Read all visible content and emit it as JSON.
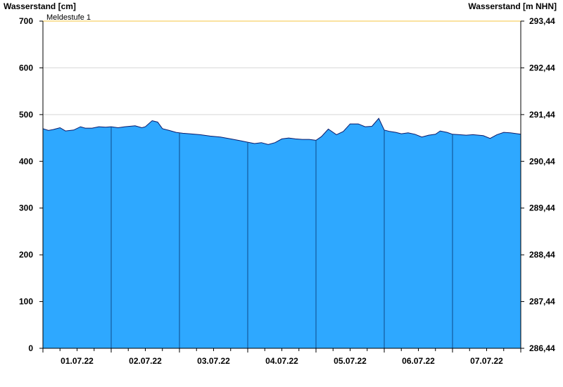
{
  "chart_data": {
    "type": "area",
    "ylabel_left": "Wasserstand [cm]",
    "ylabel_right": "Wasserstand [m NHN]",
    "ylim": [
      0,
      700
    ],
    "yticks_left": [
      0,
      100,
      200,
      300,
      400,
      500,
      600,
      700
    ],
    "yticks_right": [
      "286,44",
      "287,44",
      "288,44",
      "289,44",
      "290,44",
      "291,44",
      "292,44",
      "293,44"
    ],
    "days": [
      "01.07.22",
      "02.07.22",
      "03.07.22",
      "04.07.22",
      "05.07.22",
      "06.07.22",
      "07.07.22"
    ],
    "threshold": {
      "label": "Meldestufe 1",
      "value": 700,
      "color": "#f5c542"
    },
    "fill_color": "#2ea8ff",
    "grid": true,
    "series": [
      {
        "x_days": [
          0.0,
          0.08,
          0.15,
          0.25,
          0.33,
          0.45,
          0.55,
          0.62,
          0.72,
          0.82,
          0.92,
          1.0,
          1.1,
          1.2,
          1.35,
          1.45,
          1.5,
          1.6,
          1.68,
          1.75,
          1.85,
          1.95,
          2.05,
          2.15,
          2.3,
          2.45,
          2.6,
          2.75,
          2.9,
          3.0,
          3.1,
          3.2,
          3.3,
          3.4,
          3.5,
          3.6,
          3.7,
          3.8,
          3.9,
          4.0,
          4.08,
          4.18,
          4.3,
          4.4,
          4.5,
          4.62,
          4.72,
          4.82,
          4.92,
          5.0,
          5.08,
          5.17,
          5.25,
          5.35,
          5.45,
          5.55,
          5.65,
          5.75,
          5.82,
          5.92,
          6.0,
          6.1,
          6.2,
          6.3,
          6.45,
          6.55,
          6.65,
          6.75,
          6.85,
          7.0
        ],
        "values": [
          470,
          466,
          468,
          472,
          465,
          467,
          474,
          471,
          471,
          474,
          473,
          474,
          472,
          474,
          476,
          472,
          474,
          487,
          484,
          470,
          466,
          462,
          460,
          459,
          457,
          454,
          452,
          448,
          444,
          441,
          438,
          440,
          436,
          440,
          448,
          450,
          448,
          447,
          447,
          445,
          453,
          469,
          457,
          464,
          480,
          480,
          474,
          475,
          492,
          467,
          464,
          462,
          459,
          461,
          458,
          452,
          456,
          458,
          465,
          462,
          458,
          457,
          456,
          457,
          455,
          449,
          457,
          462,
          461,
          458
        ]
      }
    ]
  }
}
